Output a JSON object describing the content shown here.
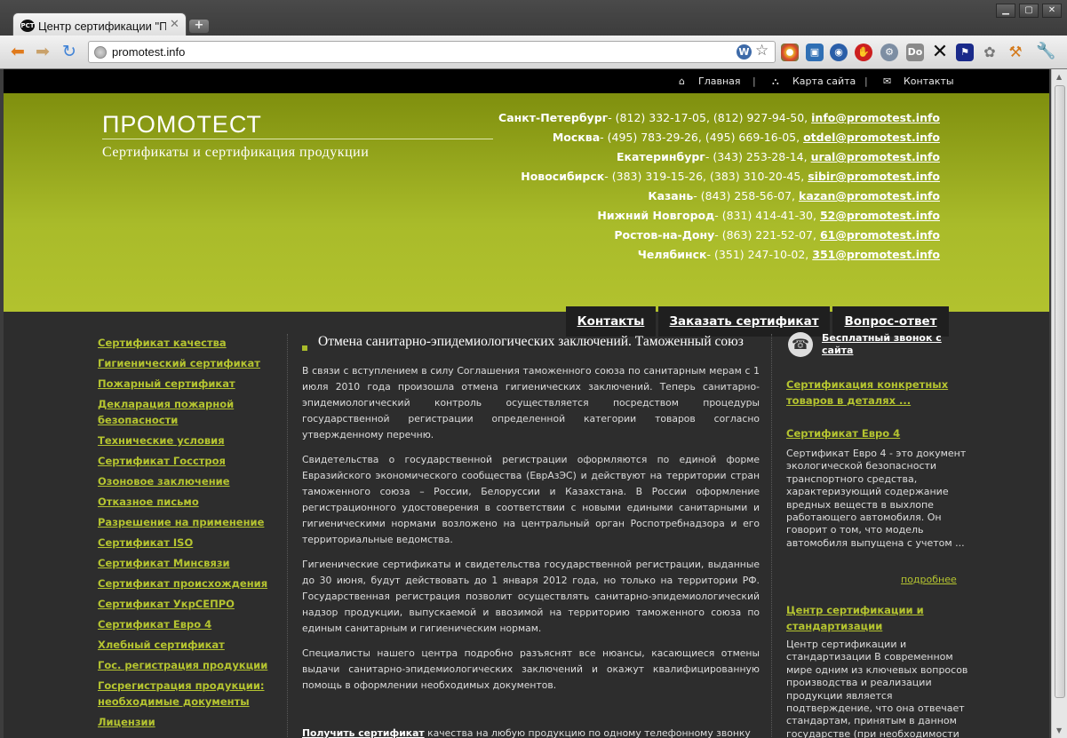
{
  "browser": {
    "tab_title": "Центр сертификации \"Пр",
    "favicon_text": "PCT",
    "url": "promotest.info"
  },
  "topnav": {
    "home": "Главная",
    "sitemap": "Карта сайта",
    "contacts": "Контакты",
    "separator": "|"
  },
  "header": {
    "logo": "ПРОМОТЕСТ",
    "slogan": "Сертификаты и сертификация продукции",
    "contacts": [
      {
        "city": "Санкт-Петербург",
        "phones": "(812) 332-17-05, (812) 927-94-50,",
        "email": "info@promotest.info"
      },
      {
        "city": "Москва",
        "phones": "(495) 783-29-26, (495) 669-16-05,",
        "email": "otdel@promotest.info"
      },
      {
        "city": "Екатеринбург",
        "phones": "(343) 253-28-14,",
        "email": "ural@promotest.info"
      },
      {
        "city": "Новосибирск",
        "phones": "(383) 319-15-26, (383) 310-20-45,",
        "email": "sibir@promotest.info"
      },
      {
        "city": "Казань",
        "phones": "(843) 258-56-07,",
        "email": "kazan@promotest.info"
      },
      {
        "city": "Нижний Новгород",
        "phones": "(831) 414-41-30,",
        "email": "52@promotest.info"
      },
      {
        "city": "Ростов-на-Дону",
        "phones": "(863) 221-52-07,",
        "email": "61@promotest.info"
      },
      {
        "city": "Челябинск",
        "phones": "(351) 247-10-02,",
        "email": "351@promotest.info"
      }
    ],
    "tabs": [
      "Контакты",
      "Заказать сертификат",
      "Вопрос-ответ"
    ]
  },
  "left_menu": [
    "Сертификат качества",
    "Гигиенический сертификат",
    "Пожарный сертификат",
    "Декларация пожарной безопасности",
    "Технические условия",
    "Сертификат Госстроя",
    "Озоновое заключение",
    "Отказное письмо",
    "Разрешение на применение",
    "Сертификат ISO",
    "Сертификат Минсвязи",
    "Сертификат происхождения",
    "Сертификат УкрСЕПРО",
    "Сертификат Евро 4",
    "Хлебный сертификат",
    "Гос. регистрация продукции",
    "Госрегистрация продукции: необходимые документы",
    "Лицензии"
  ],
  "article": {
    "title": "Отмена санитарно-эпидемиологических заключений. Таможенный союз",
    "paragraphs": [
      "В связи с вступлением в силу Соглашения таможенного союза по санитарным мерам с 1 июля 2010 года произошла отмена гигиенических заключений. Теперь санитарно-эпидемиологический контроль осуществляется посредством процедуры государственной регистрации определенной категории товаров согласно утвержденному перечню.",
      "Свидетельства о государственной регистрации оформляются по единой форме Евразийского экономического сообщества (ЕврАзЭС) и действуют на территории стран таможенного союза – России, Белоруссии и Казахстана. В России оформление регистрационного удостоверения в соответствии с новыми едиными санитарными и гигиеническими нормами возложено на центральный орган Роспотребнадзора и его территориальные ведомства.",
      "Гигиенические сертификаты и свидетельства государственной регистрации, выданные до 30 июня, будут действовать до 1 января 2012 года, но только на территории РФ. Государственная регистрация позволит осуществлять санитарно-эпидемиологический надзор продукции, выпускаемой и ввозимой на территорию таможенного союза по единым санитарным и гигиеническим нормам.",
      "Специалисты нашего центра подробно разъяснят все нюансы, касающиеся отмены выдачи санитарно-эпидемиологических заключений и окажут квалифицированную помощь в оформлении необходимых документов."
    ],
    "bottom_bold": "Получить сертификат",
    "bottom_rest": "качества на любую продукцию по одному телефонному звонку"
  },
  "sidebar": {
    "call": "Бесплатный звонок с сайта",
    "concrete": "Сертификация конкретных товаров в деталях ...",
    "euro4_title": "Сертификат Евро 4",
    "euro4_text": "Сертификат Евро 4 - это документ экологической безопасности транспортного средства, характеризующий содержание вредных веществ в выхлопе работающего автомобиля. Он говорит о том, что модель автомобиля выпущена с учетом ...",
    "more": "подробнее",
    "center_title": "Центр сертификации и стандартизации",
    "center_text": "Центр сертификации и стандартизации В современном мире одним из ключевых вопросов производства и реализации продукции является подтверждение, что она отвечает стандартам, принятым в данном государстве (при необходимости"
  }
}
